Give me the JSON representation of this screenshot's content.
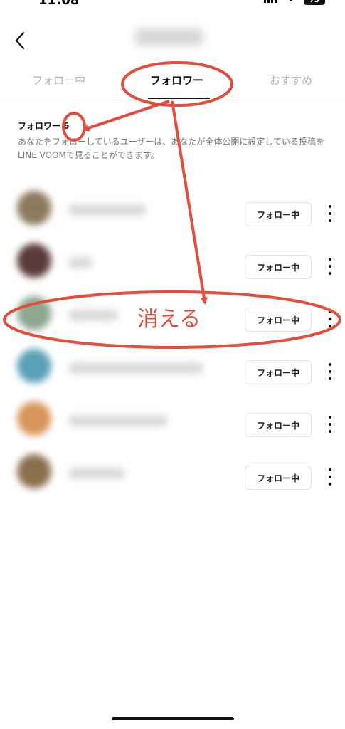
{
  "status_bar": {
    "time": "11:08",
    "battery": "73"
  },
  "tabs": [
    {
      "label": "フォロー中"
    },
    {
      "label": "フォロワー"
    },
    {
      "label": "おすすめ"
    }
  ],
  "followers": {
    "title": "フォロワー",
    "count": "6",
    "description": "あなたをフォローしているユーザーは、あなたが全体公開に設定している投稿をLINE VOOMで見ることができます。"
  },
  "list": {
    "items": [
      {
        "button": "フォロー中"
      },
      {
        "button": "フォロー中"
      },
      {
        "button": "フォロー中"
      },
      {
        "button": "フォロー中"
      },
      {
        "button": "フォロー中"
      },
      {
        "button": "フォロー中"
      }
    ]
  },
  "annotation": {
    "text": "消える",
    "color": "#e24d3c"
  }
}
